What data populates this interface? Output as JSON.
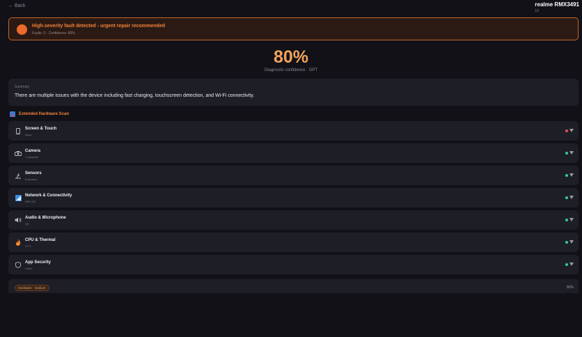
{
  "nav": {
    "back_label": "← Back"
  },
  "device": {
    "name": "realme RMX3491",
    "version": "13"
  },
  "alert": {
    "title": "High-severity fault detected - urgent repair recommended",
    "subtitle": "Faults: 3 · Confidence: 80%",
    "color": "#ec6a2c"
  },
  "confidence": {
    "value": "80%",
    "label": "Diagnostic confidence · GPT"
  },
  "summary": {
    "label": "Summary",
    "text": "There are multiple issues with the device including fast charging, touchscreen detection, and Wi-Fi connectivity."
  },
  "scan": {
    "title": "Extended Hardware Scan",
    "icon": "chart-icon"
  },
  "rows": [
    {
      "title": "Screen & Touch",
      "sub": "Issue",
      "icon": "phone-icon",
      "status": "error",
      "status_color": "#e85050"
    },
    {
      "title": "Camera",
      "sub": "1 cameras",
      "icon": "camera-icon",
      "status": "ok",
      "status_color": "#2fd08a"
    },
    {
      "title": "Sensors",
      "sub": "8 sensors",
      "icon": "microscope-icon",
      "status": "ok",
      "status_color": "#2fd08a"
    },
    {
      "title": "Network & Connectivity",
      "sub": "WiFi ON",
      "icon": "signal-icon",
      "status": "ok",
      "status_color": "#2fd08a"
    },
    {
      "title": "Audio & Microphone",
      "sub": "OK",
      "icon": "speaker-icon",
      "status": "ok",
      "status_color": "#2fd08a"
    },
    {
      "title": "CPU & Thermal",
      "sub": "37°C",
      "icon": "fire-icon",
      "status": "ok",
      "status_color": "#2fd08a"
    },
    {
      "title": "App Security",
      "sub": "Clean",
      "icon": "shield-icon",
      "status": "ok",
      "status_color": "#2fd08a"
    }
  ],
  "hardware": {
    "badge": "Hardware · medium",
    "value": "80%"
  }
}
